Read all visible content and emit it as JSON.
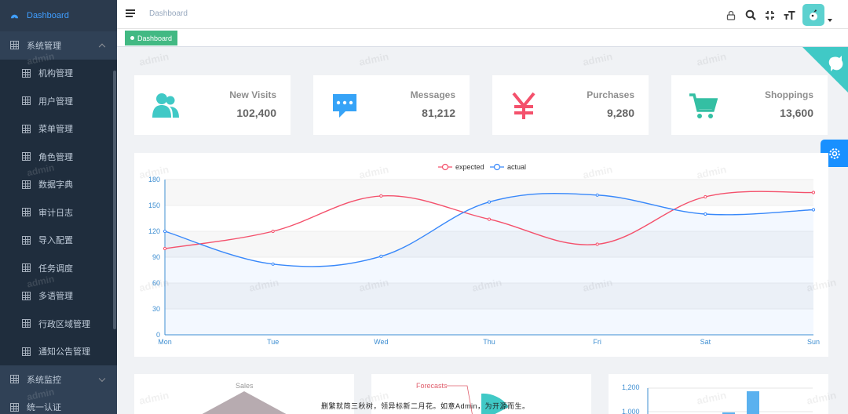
{
  "sidebar": {
    "top_item": "Dashboard",
    "group1": "系统管理",
    "items": [
      "机构管理",
      "用户管理",
      "菜单管理",
      "角色管理",
      "数据字典",
      "审计日志",
      "导入配置",
      "任务调度",
      "多语管理",
      "行政区域管理",
      "通知公告管理"
    ],
    "group2": "系统监控",
    "group3": "统一认证"
  },
  "header": {
    "breadcrumb": "Dashboard"
  },
  "tags": {
    "active": "Dashboard"
  },
  "watermark": "admin",
  "cards": [
    {
      "label": "New Visits",
      "value": "102,400",
      "icon": "peoples-icon",
      "color": "#40c9c6"
    },
    {
      "label": "Messages",
      "value": "81,212",
      "icon": "message-icon",
      "color": "#36a3f7"
    },
    {
      "label": "Purchases",
      "value": "9,280",
      "icon": "money-icon",
      "color": "#f4516c"
    },
    {
      "label": "Shoppings",
      "value": "13,600",
      "icon": "shopping-icon",
      "color": "#34bfa3"
    }
  ],
  "chart_data": {
    "type": "line",
    "categories": [
      "Mon",
      "Tue",
      "Wed",
      "Thu",
      "Fri",
      "Sat",
      "Sun"
    ],
    "series": [
      {
        "name": "expected",
        "values": [
          100,
          120,
          161,
          134,
          105,
          160,
          165
        ],
        "color": "#f4516c"
      },
      {
        "name": "actual",
        "values": [
          120,
          82,
          91,
          154,
          162,
          140,
          145
        ],
        "color": "#3888fa"
      }
    ],
    "ylim": [
      0,
      180
    ],
    "yticks": [
      0,
      30,
      60,
      90,
      120,
      150,
      180
    ],
    "legend": "top-center",
    "smooth": true
  },
  "bottom": {
    "sales_label": "Sales",
    "forecasts_label": "Forecasts",
    "bar_ticks": [
      "1,200",
      "1,000"
    ]
  },
  "footer": {
    "quote": "删繁就简三秋树，领异标新二月花。如意Admin，为开源而生。"
  }
}
